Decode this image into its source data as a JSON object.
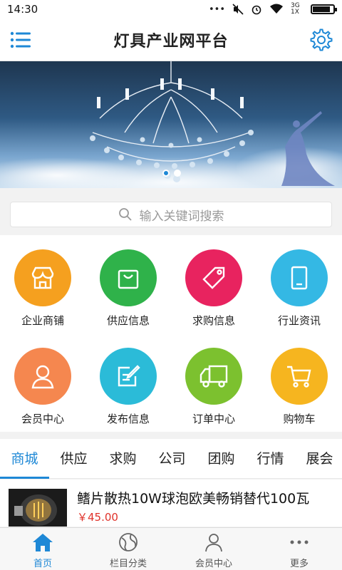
{
  "status": {
    "time": "14:30",
    "network": "3G 1X",
    "battery_level": 0.85
  },
  "header": {
    "title": "灯具产业网平台",
    "menu_icon": "menu-icon",
    "settings_icon": "gear-icon"
  },
  "banner": {
    "slide_count": 2,
    "active_slide": 0
  },
  "search": {
    "placeholder": "输入关键词搜索"
  },
  "grid": [
    {
      "label": "企业商铺",
      "color": "#f5a01f",
      "icon": "store-icon"
    },
    {
      "label": "供应信息",
      "color": "#2fb24a",
      "icon": "shopping-bag-icon"
    },
    {
      "label": "求购信息",
      "color": "#e8235f",
      "icon": "tag-icon"
    },
    {
      "label": "行业资讯",
      "color": "#34b8e4",
      "icon": "tablet-icon"
    },
    {
      "label": "会员中心",
      "color": "#f5874f",
      "icon": "user-icon"
    },
    {
      "label": "发布信息",
      "color": "#2bbbd8",
      "icon": "edit-icon"
    },
    {
      "label": "订单中心",
      "color": "#7cc12f",
      "icon": "truck-icon"
    },
    {
      "label": "购物车",
      "color": "#f6b51f",
      "icon": "cart-icon"
    }
  ],
  "tabs": [
    "商城",
    "供应",
    "求购",
    "公司",
    "团购",
    "行情",
    "展会"
  ],
  "active_tab": 0,
  "product": {
    "name": "鳍片散热10W球泡欧美畅销替代100瓦",
    "price": "￥45.00"
  },
  "bottom_nav": [
    {
      "label": "首页",
      "icon": "home-icon"
    },
    {
      "label": "栏目分类",
      "icon": "globe-icon"
    },
    {
      "label": "会员中心",
      "icon": "user-icon"
    },
    {
      "label": "更多",
      "icon": "more-icon"
    }
  ],
  "colors": {
    "accent": "#1e88d6",
    "price": "#e0322a"
  }
}
